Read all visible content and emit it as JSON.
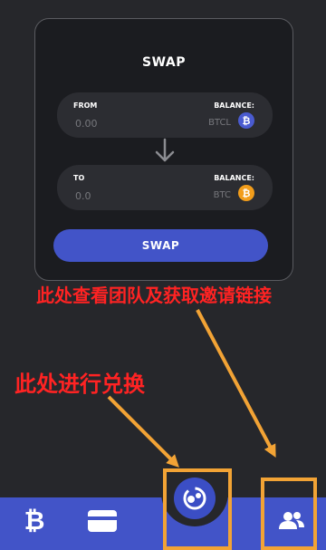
{
  "swap_card": {
    "title": "SWAP",
    "from": {
      "label": "FROM",
      "balance_label": "BALANCE:",
      "amount": "0.00",
      "token": "BTCL",
      "coin_icon": "bitcoin-icon",
      "coin_color": "#4a5bd0"
    },
    "to": {
      "label": "TO",
      "balance_label": "BALANCE:",
      "amount": "0.0",
      "token": "BTC",
      "coin_icon": "bitcoin-icon",
      "coin_color": "#f29d1b"
    },
    "swap_button_label": "SWAP"
  },
  "annotations": {
    "team_hint": "此处查看团队及获取邀请链接",
    "swap_hint": "此处进行兑换",
    "highlight_color": "#f2a335",
    "text_color": "#ff2323"
  },
  "bottom_nav": {
    "items": [
      {
        "icon": "bitcoin-icon",
        "symbol": "₿"
      },
      {
        "icon": "wallet-icon"
      },
      {
        "icon": "swap-icon"
      },
      {
        "icon": "team-icon"
      }
    ],
    "color": "#4254c8"
  }
}
